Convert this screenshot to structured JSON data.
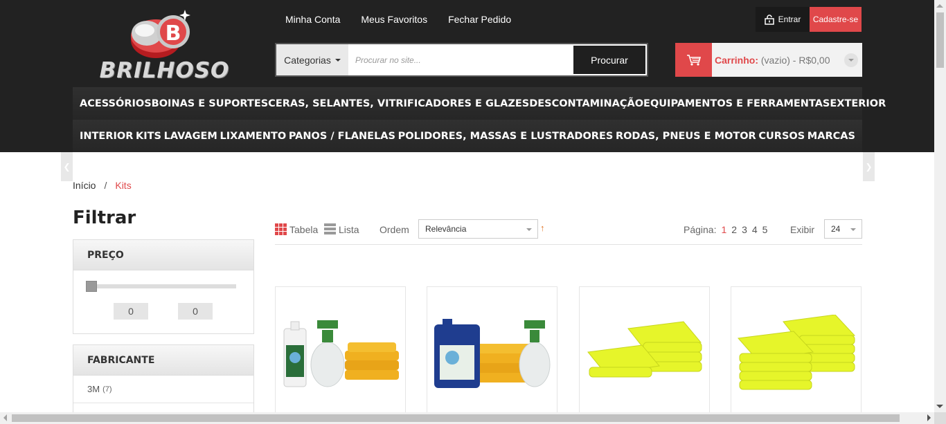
{
  "brand": {
    "name": "BRILHOSO",
    "logo_letter": "B",
    "accent": "#e0484a"
  },
  "toplinks": [
    "Minha Conta",
    "Meus Favoritos",
    "Fechar Pedido"
  ],
  "auth": {
    "login": "Entrar",
    "register": "Cadastre-se"
  },
  "search": {
    "categories": "Categorias",
    "placeholder": "Procurar no site...",
    "button": "Procurar"
  },
  "cart": {
    "label": "Carrinho:",
    "status": "(vazio) - R$0,00"
  },
  "menu_row1": [
    "ACESSÓRIOS",
    "BOINAS E SUPORTES",
    "CERAS, SELANTES, VITRIFICADORES E GLAZES",
    "DESCONTAMINAÇÃO",
    "EQUIPAMENTOS E FERRAMENTAS",
    "EXTERIOR"
  ],
  "menu_row2": [
    "INTERIOR",
    "KITS",
    "LAVAGEM",
    "LIXAMENTO",
    "PANOS / FLANELAS",
    "POLIDORES, MASSAS E LUSTRADORES",
    "RODAS, PNEUS E MOTOR",
    "CURSOS",
    "MARCAS"
  ],
  "breadcrumb": {
    "home": "Início",
    "sep": "/",
    "current": "Kits"
  },
  "filter": {
    "title": "Filtrar",
    "price": {
      "heading": "PREÇO",
      "min": "0",
      "max": "0"
    },
    "manufacturer": {
      "heading": "FABRICANTE",
      "items": [
        {
          "name": "3M",
          "count": "(7)"
        }
      ]
    }
  },
  "toolbar": {
    "view_grid": "Tabela",
    "view_list": "Lista",
    "order_label": "Ordem",
    "order_value": "Relevância",
    "page_label": "Página:",
    "pages": [
      "1",
      "2",
      "3",
      "4",
      "5"
    ],
    "current_page": "1",
    "show_label": "Exibir",
    "show_value": "24"
  },
  "products": [
    {
      "image": "kit-bottle-sprayer-towels"
    },
    {
      "image": "kit-gallon-towels-sprayer"
    },
    {
      "image": "yellow-microfiber-stacks-small"
    },
    {
      "image": "yellow-microfiber-stacks-large"
    }
  ],
  "icons": [
    "lock-icon",
    "cart-icon",
    "grid-icon",
    "list-icon",
    "chevron-left-icon",
    "chevron-right-icon",
    "sort-arrow-icon"
  ]
}
